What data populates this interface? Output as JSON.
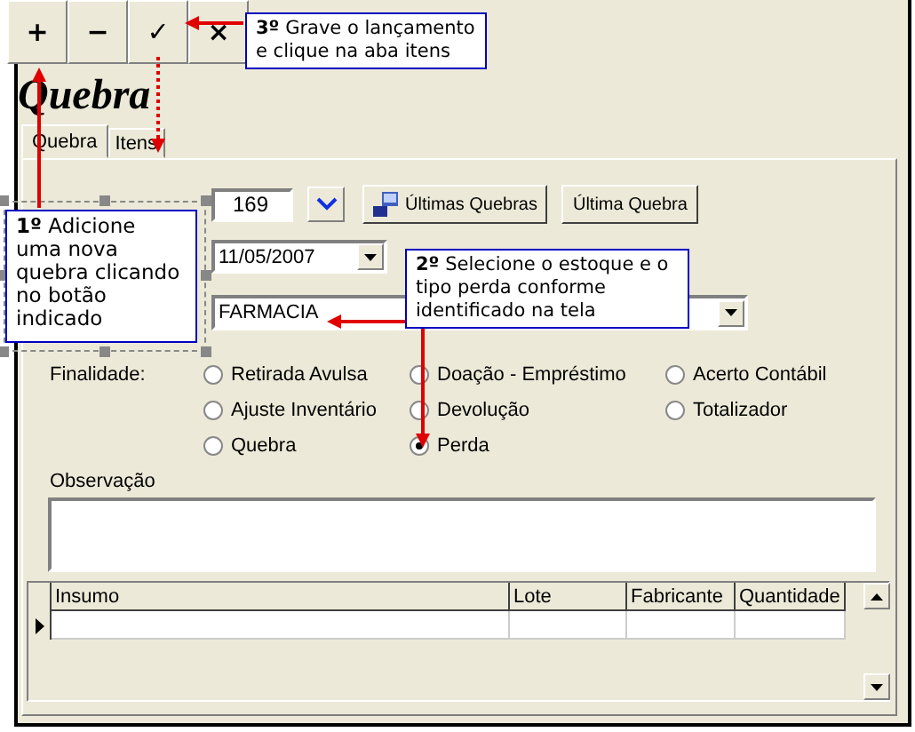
{
  "toolbar": [
    {
      "label": "+"
    },
    {
      "label": "−"
    },
    {
      "label": "✓"
    },
    {
      "label": "×"
    }
  ],
  "title": "Quebra",
  "tabs": [
    {
      "label": "Quebra",
      "selected": true
    },
    {
      "label": "Itens",
      "selected": false
    }
  ],
  "form": {
    "number": "169",
    "buttons": [
      "Últimas Quebras",
      "Última Quebra"
    ],
    "date": "11/05/2007",
    "stock": "FARMACIA"
  },
  "purpose": {
    "label": "Finalidade:",
    "options": [
      {
        "label": "Retirada Avulsa",
        "selected": false
      },
      {
        "label": "Ajuste Inventário",
        "selected": false
      },
      {
        "label": "Quebra",
        "selected": false
      },
      {
        "label": "Doação - Empréstimo",
        "selected": false
      },
      {
        "label": "Devolução",
        "selected": false
      },
      {
        "label": "Perda",
        "selected": true
      },
      {
        "label": "Acerto Contábil",
        "selected": false
      },
      {
        "label": "Totalizador",
        "selected": false
      }
    ]
  },
  "notes": {
    "label": "Observação"
  },
  "table": {
    "columns": [
      "Insumo",
      "Lote",
      "Fabricante",
      "Quantidade"
    ]
  },
  "callouts": [
    {
      "text": "**1º** Adicione uma nova quebra clicando no botão indicado"
    },
    {
      "text": "**2º** Selecione o estoque e o tipo perda conforme identificado na tela"
    },
    {
      "text": "**3º** Grave o lançamento e clique na aba itens"
    }
  ]
}
